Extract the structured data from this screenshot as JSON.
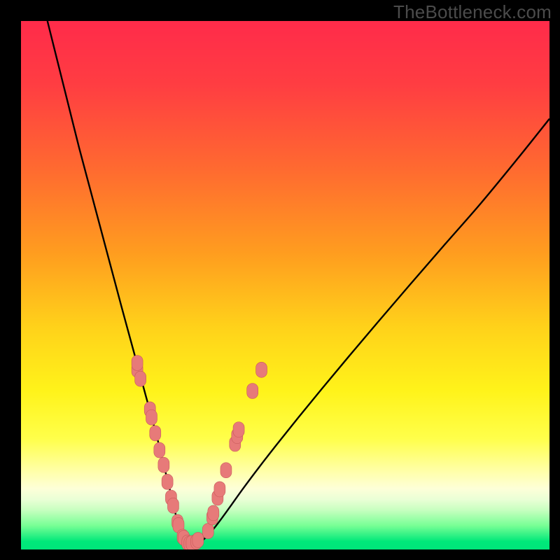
{
  "watermark": "TheBottleneck.com",
  "colors": {
    "black": "#000000",
    "curve": "#000000",
    "marker_fill": "#e77a79",
    "marker_stroke": "#c95a5a"
  },
  "gradient_stops": [
    {
      "offset": 0.0,
      "color": "#ff2b4a"
    },
    {
      "offset": 0.12,
      "color": "#ff3d42"
    },
    {
      "offset": 0.28,
      "color": "#ff6a30"
    },
    {
      "offset": 0.44,
      "color": "#ff9d1f"
    },
    {
      "offset": 0.58,
      "color": "#ffd21a"
    },
    {
      "offset": 0.7,
      "color": "#fff31a"
    },
    {
      "offset": 0.79,
      "color": "#ffff4a"
    },
    {
      "offset": 0.855,
      "color": "#ffffad"
    },
    {
      "offset": 0.885,
      "color": "#fdffd8"
    },
    {
      "offset": 0.905,
      "color": "#eaffd6"
    },
    {
      "offset": 0.925,
      "color": "#c8ffc0"
    },
    {
      "offset": 0.955,
      "color": "#77ff95"
    },
    {
      "offset": 0.985,
      "color": "#00e87a"
    },
    {
      "offset": 1.0,
      "color": "#00e57a"
    }
  ],
  "chart_data": {
    "type": "line",
    "title": "",
    "xlabel": "",
    "ylabel": "",
    "xlim": [
      0,
      100
    ],
    "ylim": [
      0,
      100
    ],
    "series": [
      {
        "name": "bottleneck-curve",
        "x": [
          5,
          7,
          9,
          11,
          13,
          15,
          17,
          19,
          20.5,
          22,
          23.5,
          25,
          26.3,
          27.5,
          28.5,
          29.3,
          30,
          30.7,
          31.5,
          32.5,
          33.8,
          35.4,
          37.3,
          39.5,
          42,
          45,
          48.5,
          52.5,
          57,
          62,
          67.5,
          73.5,
          80,
          87,
          94,
          100
        ],
        "y": [
          100,
          92,
          84,
          76,
          68.5,
          61,
          53.5,
          46,
          40.5,
          35,
          29.5,
          24,
          19,
          14,
          10,
          6.5,
          4,
          2.3,
          1.3,
          1.1,
          1.4,
          2.7,
          5,
          8,
          11.5,
          15.5,
          20,
          25,
          30.5,
          36.5,
          43,
          50,
          57.5,
          65.5,
          74,
          81.5
        ]
      }
    ],
    "markers": [
      {
        "x": 22.0,
        "y": 34.0
      },
      {
        "x": 22.0,
        "y": 35.3
      },
      {
        "x": 22.6,
        "y": 32.3
      },
      {
        "x": 24.4,
        "y": 26.5
      },
      {
        "x": 24.7,
        "y": 25.0
      },
      {
        "x": 25.4,
        "y": 22.0
      },
      {
        "x": 26.2,
        "y": 18.8
      },
      {
        "x": 27.0,
        "y": 16.0
      },
      {
        "x": 27.7,
        "y": 12.8
      },
      {
        "x": 28.4,
        "y": 9.8
      },
      {
        "x": 28.8,
        "y": 8.3
      },
      {
        "x": 29.6,
        "y": 5.2
      },
      {
        "x": 29.8,
        "y": 4.6
      },
      {
        "x": 30.6,
        "y": 2.4
      },
      {
        "x": 30.8,
        "y": 2.2
      },
      {
        "x": 31.5,
        "y": 1.3
      },
      {
        "x": 31.9,
        "y": 1.1
      },
      {
        "x": 32.3,
        "y": 1.2
      },
      {
        "x": 33.2,
        "y": 1.5
      },
      {
        "x": 33.5,
        "y": 1.8
      },
      {
        "x": 35.4,
        "y": 3.5
      },
      {
        "x": 36.2,
        "y": 6.1
      },
      {
        "x": 36.4,
        "y": 6.9
      },
      {
        "x": 37.2,
        "y": 9.8
      },
      {
        "x": 37.6,
        "y": 11.4
      },
      {
        "x": 38.8,
        "y": 15.0
      },
      {
        "x": 40.5,
        "y": 20.0
      },
      {
        "x": 40.9,
        "y": 21.5
      },
      {
        "x": 41.2,
        "y": 22.7
      },
      {
        "x": 43.8,
        "y": 30.0
      },
      {
        "x": 45.5,
        "y": 34.0
      }
    ]
  }
}
